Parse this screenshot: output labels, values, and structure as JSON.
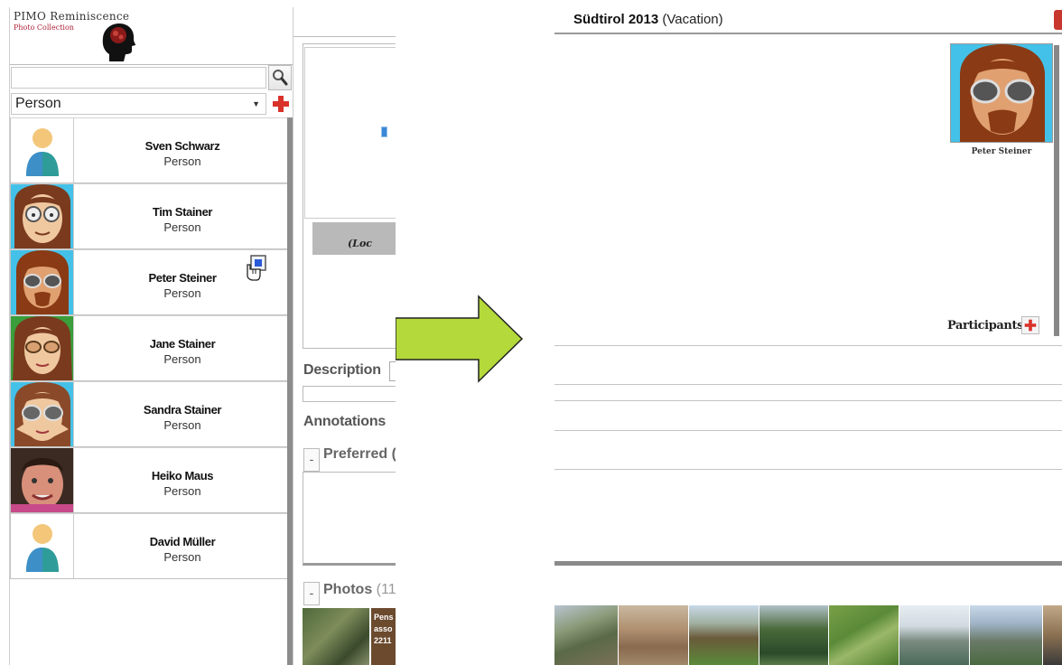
{
  "sidebar": {
    "logo": {
      "title": "PIMO Reminiscence",
      "subtitle": "Photo Collection"
    },
    "search": {
      "placeholder": "",
      "value": ""
    },
    "type_filter": {
      "selected": "Person"
    },
    "persons": [
      {
        "name": "Sven Schwarz",
        "type": "Person",
        "avatar": "default-avatar"
      },
      {
        "name": "Tim Stainer",
        "type": "Person",
        "avatar": "cartoon-glasses"
      },
      {
        "name": "Peter Steiner",
        "type": "Person",
        "avatar": "cartoon-sunglasses-beard"
      },
      {
        "name": "Jane Stainer",
        "type": "Person",
        "avatar": "cartoon-glasses-woman"
      },
      {
        "name": "Sandra Stainer",
        "type": "Person",
        "avatar": "cartoon-sunglasses-woman"
      },
      {
        "name": "Heiko Maus",
        "type": "Person",
        "avatar": "photo-man"
      },
      {
        "name": "David Müller",
        "type": "Person",
        "avatar": "default-avatar"
      }
    ]
  },
  "detail": {
    "location_label": "(Loc",
    "description_label": "Description",
    "annotations_label": "Annotations",
    "preferred_label": "Preferred (",
    "photos_label": "Photos",
    "photos_count": "(11",
    "collapse_symbol": "-",
    "thumb_sign_text": "Pens ⁠asso 2211"
  },
  "event": {
    "title": "Südtirol 2013",
    "type": "(Vacation)",
    "participant_name": "Peter Steiner",
    "participants_label": "Participants"
  },
  "colors": {
    "arrow_fill": "#b4d93a",
    "add_red": "#d9322b",
    "avatar_blue": "#44c1e8"
  },
  "icons": {
    "search": "magnifier-icon",
    "add": "red-plus-icon",
    "drag": "hand-cursor-icon",
    "close": "close-icon"
  }
}
